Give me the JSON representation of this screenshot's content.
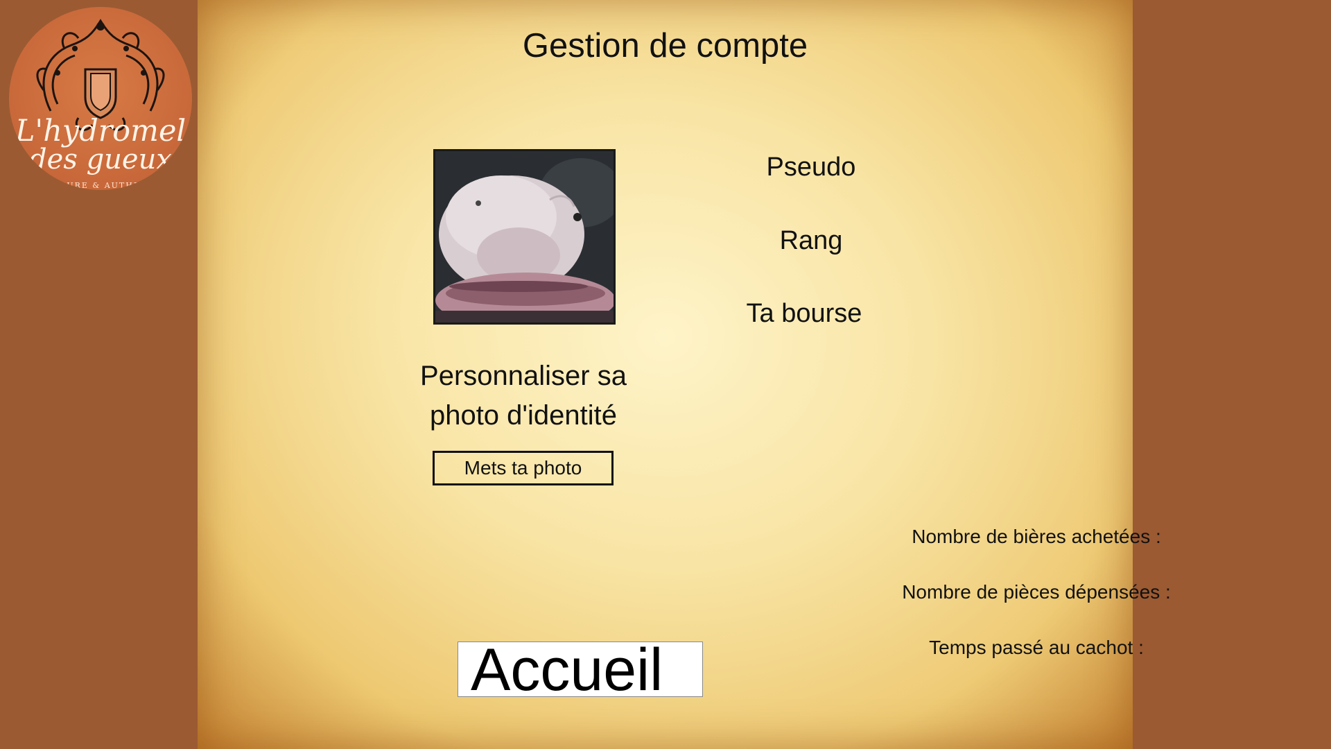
{
  "logo": {
    "line1": "L'hydromel",
    "line2": "des gueux",
    "tagline": "PURE & AUTHE"
  },
  "page": {
    "title": "Gestion de compte"
  },
  "profile": {
    "avatar_alt": "photo d'identité",
    "customize_label": "Personnaliser sa photo d'identité",
    "upload_button": "Mets ta photo"
  },
  "fields": {
    "pseudo": "Pseudo",
    "rang": "Rang",
    "bourse": "Ta bourse"
  },
  "stats": {
    "beers": "Nombre de bières achetées :",
    "coins": "Nombre de pièces dépensées :",
    "jail": "Temps passé au cachot :"
  },
  "nav": {
    "home": "Accueil"
  },
  "colors": {
    "background": "#9b5a32",
    "logo": "#c8683a",
    "parchment": "#ecc979"
  }
}
